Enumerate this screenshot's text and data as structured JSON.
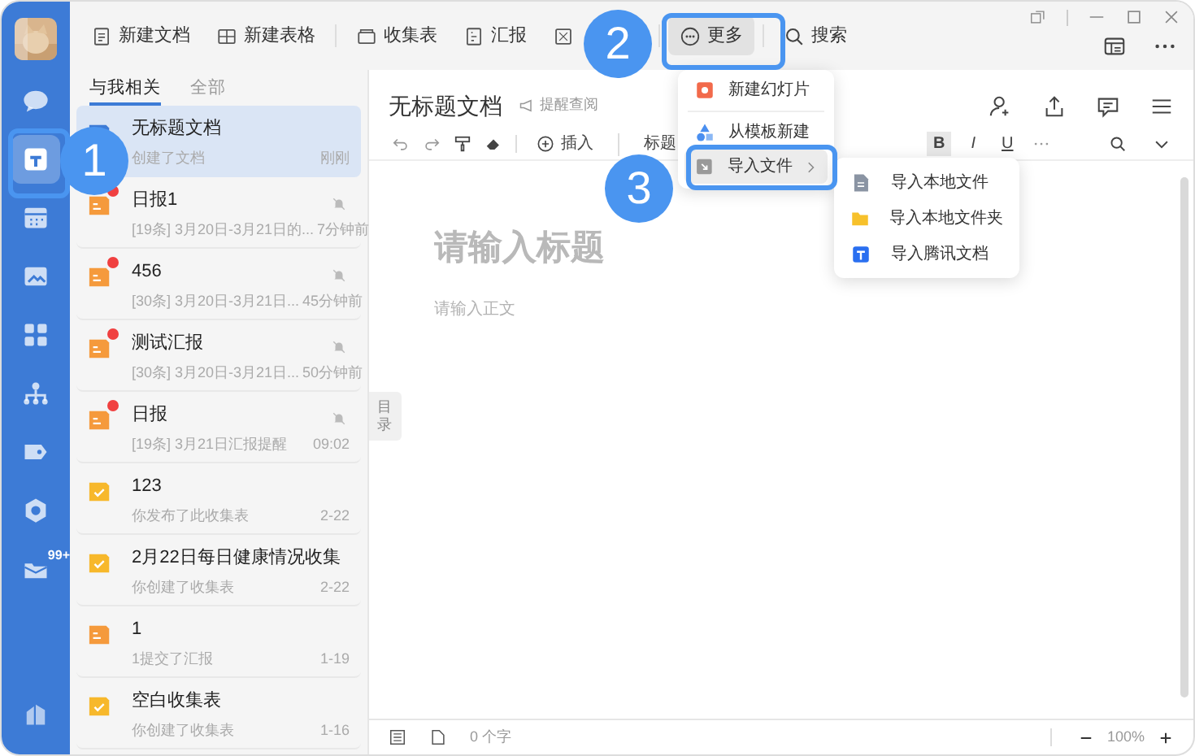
{
  "sidebar": {
    "items": [
      {
        "selected": false
      },
      {
        "selected": true
      },
      {
        "selected": false
      },
      {
        "selected": false
      },
      {
        "selected": false
      },
      {
        "selected": false
      },
      {
        "selected": false
      },
      {
        "selected": false
      },
      {
        "selected": false,
        "badge": "99+"
      },
      {
        "selected": false
      }
    ]
  },
  "toolbar": {
    "actions": [
      {
        "label": "新建文档"
      },
      {
        "label": "新建表格"
      },
      {
        "label": "收集表"
      },
      {
        "label": "汇报"
      }
    ],
    "more_button": {
      "label": "更多",
      "pressed": true
    },
    "search_button": {
      "label": "搜索"
    }
  },
  "list": {
    "tabs": [
      {
        "label": "与我相关",
        "selected": true
      },
      {
        "label": "全部",
        "selected": false
      }
    ],
    "items": [
      {
        "kind": "doc",
        "title": "无标题文档",
        "subtitle": "创建了文档",
        "time": "刚刚",
        "selected": true,
        "unread": false,
        "muted": false
      },
      {
        "kind": "report",
        "title": "日报1",
        "subtitle": "[19条] 3月20日-3月21日的...",
        "time": "7分钟前",
        "selected": false,
        "unread": true,
        "muted": true
      },
      {
        "kind": "report",
        "title": "456",
        "subtitle": "[30条] 3月20日-3月21日...",
        "time": "45分钟前",
        "selected": false,
        "unread": true,
        "muted": true
      },
      {
        "kind": "report",
        "title": "测试汇报",
        "subtitle": "[30条] 3月20日-3月21日...",
        "time": "50分钟前",
        "selected": false,
        "unread": true,
        "muted": true
      },
      {
        "kind": "report",
        "title": "日报",
        "subtitle": "[19条] 3月21日汇报提醒",
        "time": "09:02",
        "selected": false,
        "unread": true,
        "muted": true
      },
      {
        "kind": "form",
        "title": "123",
        "subtitle": "你发布了此收集表",
        "time": "2-22",
        "selected": false,
        "unread": false,
        "muted": false
      },
      {
        "kind": "form",
        "title": "2月22日每日健康情况收集",
        "subtitle": "你创建了收集表",
        "time": "2-22",
        "selected": false,
        "unread": false,
        "muted": false
      },
      {
        "kind": "report",
        "title": "1",
        "subtitle": "1提交了汇报",
        "time": "1-19",
        "selected": false,
        "unread": false,
        "muted": false
      },
      {
        "kind": "form",
        "title": "空白收集表",
        "subtitle": "你创建了收集表",
        "time": "1-16",
        "selected": false,
        "unread": false,
        "muted": false
      }
    ]
  },
  "document": {
    "title": "无标题文档",
    "remind": "提醒查阅",
    "insert": "插入",
    "heading": "标题",
    "format_buttons": [
      {
        "label": "B",
        "active": true
      },
      {
        "label": "I",
        "active": false
      },
      {
        "label": "U",
        "active": false
      }
    ],
    "title_placeholder": "请输入标题",
    "body_placeholder": "请输入正文",
    "toc": "目录",
    "word_count": "0 个字",
    "zoom": "100%"
  },
  "menu": {
    "items": [
      {
        "kind": "slides",
        "label": "新建幻灯片",
        "hovered": false,
        "submenu": false
      },
      {
        "kind": "template",
        "label": "从模板新建",
        "hovered": false,
        "submenu": false
      },
      {
        "kind": "import",
        "label": "导入文件",
        "hovered": true,
        "submenu": true
      }
    ]
  },
  "submenu": {
    "items": [
      {
        "kind": "file",
        "label": "导入本地文件"
      },
      {
        "kind": "folder",
        "label": "导入本地文件夹"
      },
      {
        "kind": "tencent",
        "label": "导入腾讯文档"
      }
    ]
  },
  "callouts": [
    {
      "number": "1"
    },
    {
      "number": "2"
    },
    {
      "number": "3"
    }
  ]
}
